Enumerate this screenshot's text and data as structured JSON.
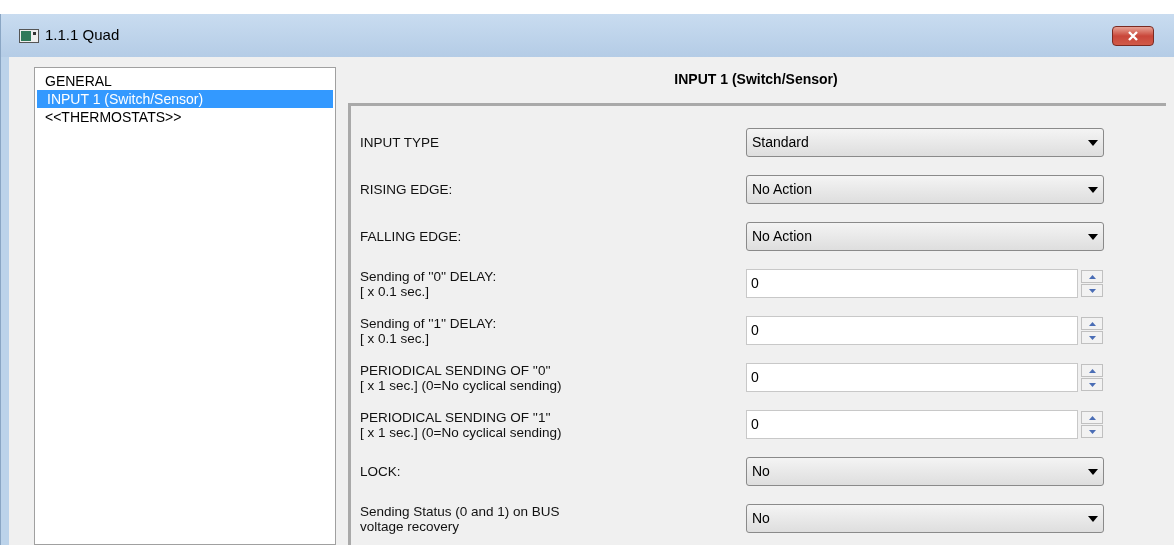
{
  "window": {
    "title": "1.1.1 Quad"
  },
  "sidebar": {
    "items": [
      {
        "label": "GENERAL",
        "selected": false
      },
      {
        "label": "INPUT 1 (Switch/Sensor)",
        "selected": true
      },
      {
        "label": "<<THERMOSTATS>>",
        "selected": false
      }
    ]
  },
  "panel": {
    "title": "INPUT 1 (Switch/Sensor)",
    "params": [
      {
        "kind": "dropdown",
        "label": [
          "INPUT TYPE"
        ],
        "value": "Standard"
      },
      {
        "kind": "dropdown",
        "label": [
          "RISING EDGE:"
        ],
        "value": "No Action"
      },
      {
        "kind": "dropdown",
        "label": [
          "FALLING EDGE:"
        ],
        "value": "No Action"
      },
      {
        "kind": "spin",
        "label": [
          "Sending of ''0'' DELAY:",
          "[ x 0.1 sec.]"
        ],
        "value": "0"
      },
      {
        "kind": "spin",
        "label": [
          "Sending of ''1'' DELAY:",
          "[ x 0.1 sec.]"
        ],
        "value": "0"
      },
      {
        "kind": "spin",
        "label": [
          "PERIODICAL SENDING OF ''0''",
          "[ x 1 sec.] (0=No cyclical sending)"
        ],
        "value": "0"
      },
      {
        "kind": "spin",
        "label": [
          "PERIODICAL SENDING OF ''1''",
          "[ x 1 sec.] (0=No cyclical sending)"
        ],
        "value": "0"
      },
      {
        "kind": "dropdown",
        "label": [
          "LOCK:"
        ],
        "value": "No"
      },
      {
        "kind": "dropdown",
        "label": [
          "Sending Status (0 and 1) on BUS",
          "voltage recovery"
        ],
        "value": "No"
      }
    ]
  }
}
